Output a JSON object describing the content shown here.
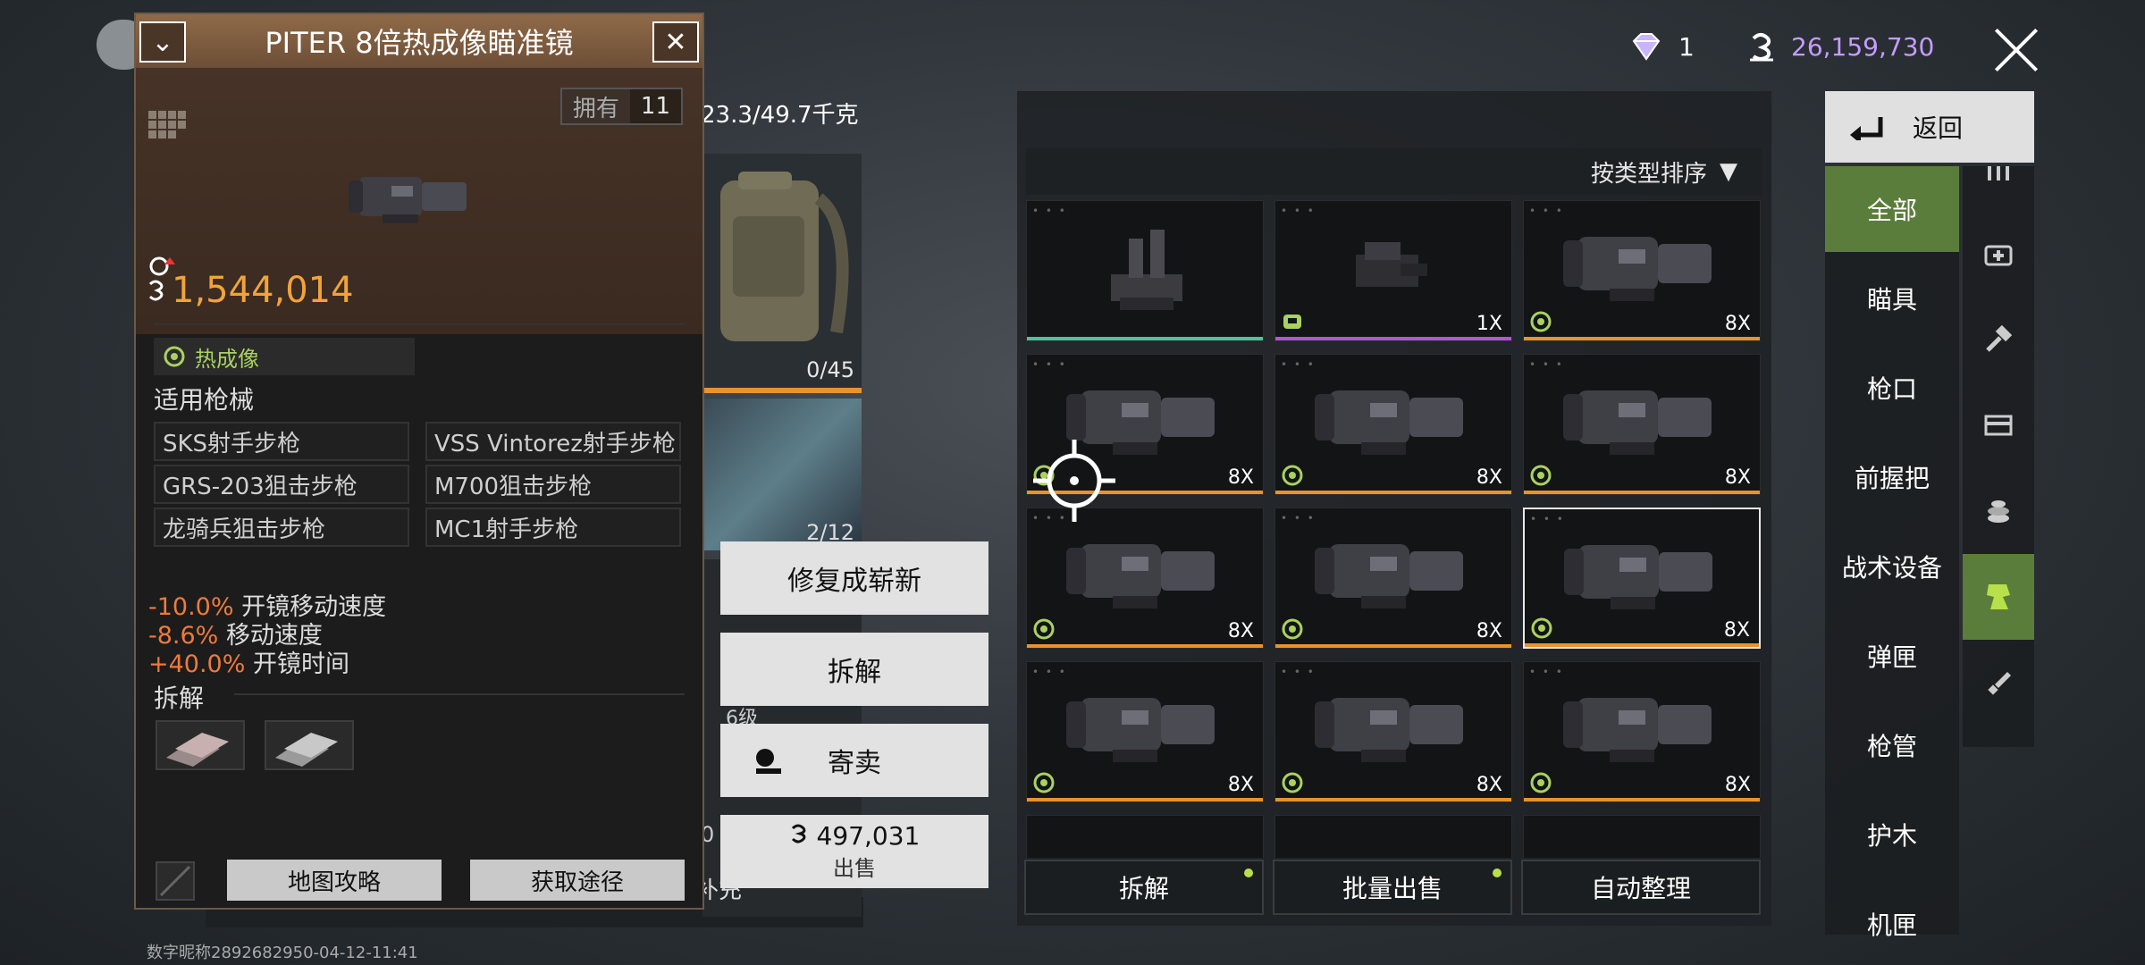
{
  "top_bar": {
    "gem_count": "1",
    "coin_count": "26,159,730"
  },
  "item_detail": {
    "title": "PITER 8倍热成像瞄准镜",
    "own_label": "拥有",
    "own_count": "11",
    "price": "1,544,014",
    "type_tag": "热成像",
    "guns_title": "适用枪械",
    "guns": [
      "SKS射手步枪",
      "VSS Vintorez射手步枪",
      "GRS-203狙击步枪",
      "M700狙击步枪",
      "龙骑兵狙击步枪",
      "MC1射手步枪"
    ],
    "stats": [
      {
        "value": "-10.0%",
        "label": "开镜移动速度"
      },
      {
        "value": "-8.6%",
        "label": "移动速度"
      },
      {
        "value": "+40.0%",
        "label": "开镜时间"
      }
    ],
    "dismantle_title": "拆解",
    "map_guide_button": "地图攻略",
    "obtain_button": "获取途径"
  },
  "backpack": {
    "weight": "23.3/49.7千克",
    "bag_count": "0/45",
    "second_count": "2/12",
    "level_text": "6级",
    "refill_text": "补充",
    "side_digit": "0"
  },
  "context_menu": {
    "repair": "修复成崭新",
    "dismantle": "拆解",
    "consign": "寄卖",
    "sell_price": "497,031",
    "sell_label": "出售"
  },
  "inventory": {
    "sort_label": "按类型排序",
    "cells": [
      {
        "kind": "iron-sight",
        "bar": "green",
        "mag": ""
      },
      {
        "kind": "red-dot",
        "bar": "purple",
        "mag": "1X"
      },
      {
        "kind": "thermal",
        "bar": "orange",
        "mag": "8X"
      },
      {
        "kind": "thermal",
        "bar": "orange",
        "mag": "8X"
      },
      {
        "kind": "thermal",
        "bar": "orange",
        "mag": "8X"
      },
      {
        "kind": "thermal",
        "bar": "orange",
        "mag": "8X"
      },
      {
        "kind": "thermal",
        "bar": "orange",
        "mag": "8X"
      },
      {
        "kind": "thermal",
        "bar": "orange",
        "mag": "8X"
      },
      {
        "kind": "thermal",
        "bar": "orange",
        "mag": "8X"
      },
      {
        "kind": "thermal",
        "bar": "orange",
        "mag": "8X"
      },
      {
        "kind": "thermal",
        "bar": "orange",
        "mag": "8X"
      },
      {
        "kind": "thermal",
        "bar": "orange",
        "mag": "8X"
      }
    ],
    "dismantle_button": "拆解",
    "bulk_sell_button": "批量出售",
    "auto_sort_button": "自动整理"
  },
  "categories": {
    "back_label": "返回",
    "items": [
      "全部",
      "瞄具",
      "枪口",
      "前握把",
      "战术设备",
      "弹匣",
      "枪管",
      "护木",
      "机匣"
    ]
  },
  "watermark": "数字昵称2892682950-04-12-11:41",
  "colors": {
    "accent_orange": "#e8932c",
    "category_active": "#5b7d3b",
    "coin_purple": "#c79bff",
    "price_orange": "#f2a33a"
  }
}
